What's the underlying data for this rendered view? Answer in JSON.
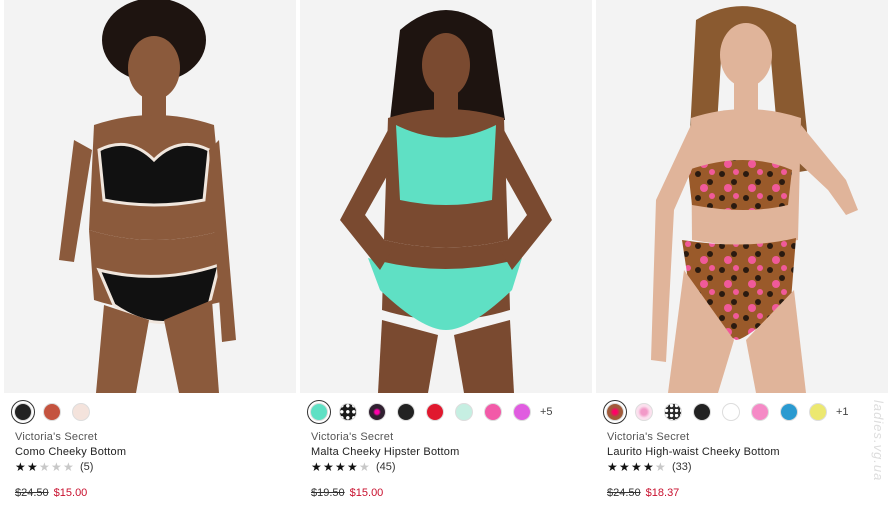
{
  "products": [
    {
      "brand": "Victoria's Secret",
      "name": "Como Cheeky Bottom",
      "rating_stars": 2,
      "rating_count": "(5)",
      "price_original": "$24.50",
      "price_sale": "$15.00",
      "swatch_colors": [
        "#222222",
        "#c4533f",
        "#f4e3dc"
      ],
      "more_colors": "",
      "suit_color": "#111111",
      "trim_color": "#f0e6dd",
      "skin_color": "#8b5a3c"
    },
    {
      "brand": "Victoria's Secret",
      "name": "Malta Cheeky Hipster Bottom",
      "rating_stars": 4,
      "rating_count": "(45)",
      "price_original": "$19.50",
      "price_sale": "$15.00",
      "swatch_colors": [
        "#5fe0c4",
        "#1a1a1a",
        "#b03070",
        "#222222",
        "#e0182e",
        "#c6efe2",
        "#f25aa8",
        "#e05ce0"
      ],
      "more_colors": "+5",
      "suit_color": "#5fe0c4",
      "trim_color": "#5fe0c4",
      "skin_color": "#7a4a30"
    },
    {
      "brand": "Victoria's Secret",
      "name": "Laurito High-waist Cheeky Bottom",
      "rating_stars": 4,
      "rating_count": "(33)",
      "price_original": "$24.50",
      "price_sale": "$18.37",
      "swatch_colors": [
        "#e07090",
        "#f29ac8",
        "#2a2a2a",
        "#222222",
        "#ffffff",
        "#f58ac6",
        "#2a9ad0",
        "#ece870"
      ],
      "more_colors": "+1",
      "suit_color": "#9a5a2a",
      "trim_color": "#f05a9a",
      "skin_color": "#e0b49a"
    }
  ],
  "watermark": "ladies.vg.ua"
}
